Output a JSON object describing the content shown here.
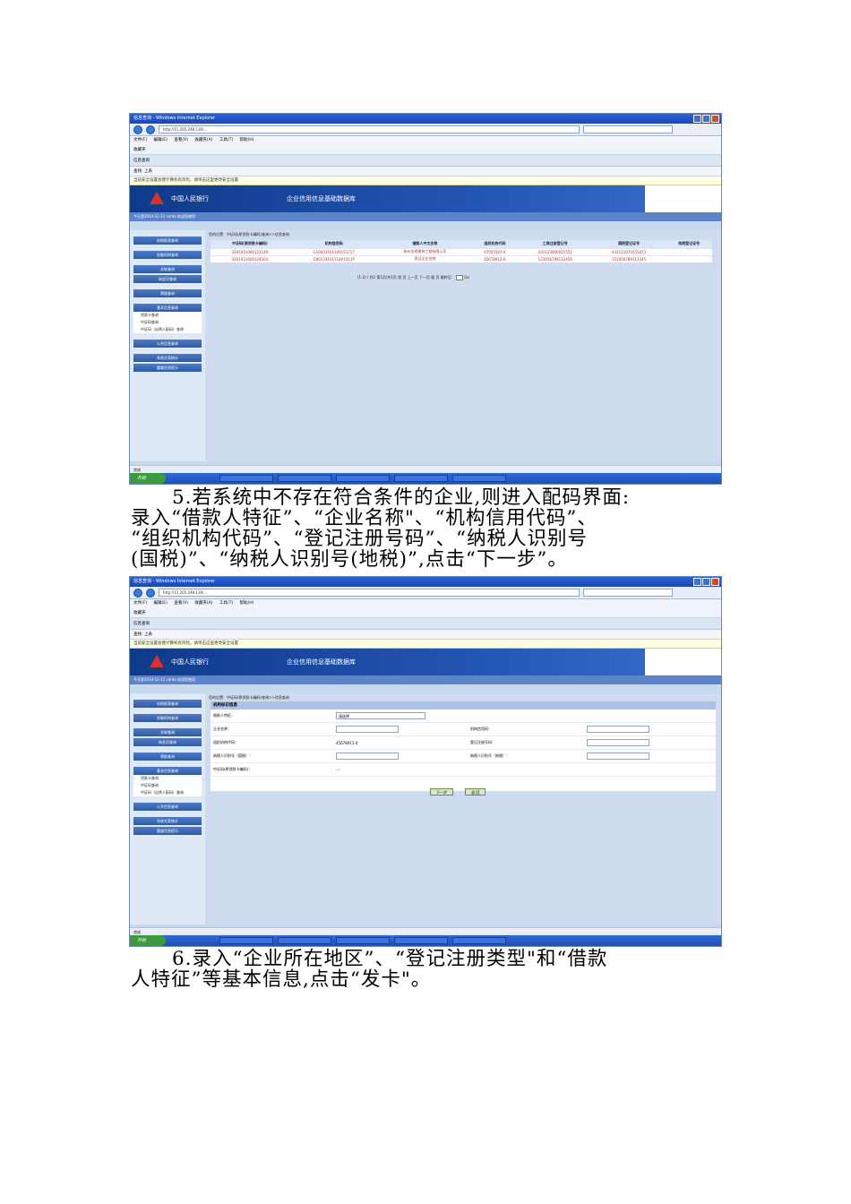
{
  "screenshot1": {
    "window_title": "信息查询 - Windows Internet Explorer",
    "address": "http://11.205.248.130/...",
    "menu": "文件(F) 编辑(E) 查看(V) 收藏夹(A) 工具(T) 帮助(H)",
    "favorites": "收藏夹",
    "tab": "信息查询",
    "find": "查找: 上表",
    "info_bar": "当前安全设置会使计算机有风险。请单击这里更改安全设置",
    "bank_name": "中国人民银行",
    "system_name": "企业信用信息基础数据库",
    "nav_left": "今天是2014-12-11 cerdo 欢迎您使用",
    "breadcrumb": "您的位置：中证码(原贷款卡编码)查询>>信息查询",
    "sidebar": [
      "机构报表查询",
      "金融机构查询",
      "关联查询",
      "纳会员查询",
      "票据查询",
      "基本信息查询",
      "贷款卡查询",
      "中证码查询",
      "中证码（自然人配码）查询",
      "公共信息查询",
      "系统文案统计",
      "重要信息提示"
    ],
    "table": {
      "headers": [
        "中证码(原贷款卡编码)",
        "机构信用码",
        "借款人中文名称",
        "组织机构代码",
        "工商注册登记号",
        "国税登记证号",
        "地税登记证号"
      ],
      "rows": [
        [
          "3301021000123149",
          "G10433101100151717",
          "杭州金桥建筑工程有限公司",
          "07055567-X",
          "431123000021551",
          "431121070555873",
          ""
        ],
        [
          "3301021000124204",
          "G0013310111401511P",
          "测试企业名称",
          "45678912-6",
          "123456789112456",
          "123456789112345",
          ""
        ]
      ]
    },
    "pager": "(1-2)  /  共2      第1页/共1页    首 页  上一页  下一页  尾 页    跳转至：",
    "go": "Go",
    "status": "完成",
    "start": "开始"
  },
  "paragraph1": [
    "5.若系统中不存在符合条件的企业,则进入配码界面:",
    "录入“借款人特征”、“企业名称\"、“机构信用代码”、",
    "“组织机构代码”、“登记注册号码”、“纳税人识别号",
    "(国税)”、“纳税人识别号(地税)”,点击“下一步”。"
  ],
  "screenshot2": {
    "form_title": "机构标识信息",
    "labels": {
      "borrower_feature": "借款人特征：",
      "company_name": "企业名称：",
      "credit_code": "机构信用码：",
      "org_code": "组织机构代码：",
      "reg_no": "登记注册号码：",
      "tax_national": "纳税人识别号（国税）：",
      "tax_local": "纳税人识别号（地税）：",
      "zz_code": "中证码(原贷款卡编码)："
    },
    "select_value": "请选择",
    "org_code_value": "45678911-4",
    "zz_code_value": "---",
    "next_button": "下一步",
    "back_button": "返 回"
  },
  "paragraph2": [
    "6.录入“企业所在地区”、“登记注册类型\"和“借款",
    "人特征”等基本信息,点击“发卡\"。"
  ]
}
